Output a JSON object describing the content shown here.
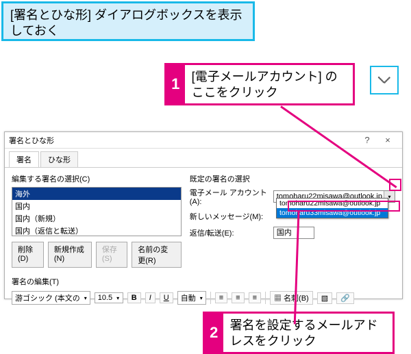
{
  "banner": "[署名とひな形] ダイアログボックスを表示しておく",
  "callout1": {
    "num": "1",
    "text": "[電子メールアカウント] のここをクリック"
  },
  "callout2": {
    "num": "2",
    "text": "署名を設定するメールアドレスをクリック"
  },
  "chevIcon": "chevron-down-icon",
  "dialog": {
    "title": "署名とひな形",
    "help": "?",
    "close": "×",
    "tabs": {
      "active": "署名",
      "inactive": "ひな形"
    },
    "left": {
      "label": "編集する署名の選択(C)",
      "items": [
        "海外",
        "国内",
        "国内（新規）",
        "国内（返信と転送）"
      ],
      "selectedIndex": 0,
      "buttons": {
        "delete": "削除(D)",
        "new": "新規作成(N)",
        "save": "保存(S)",
        "rename": "名前の変更(R)"
      }
    },
    "right": {
      "label": "既定の署名の選択",
      "rows": {
        "account": {
          "lbl": "電子メール アカウント(A):",
          "value": "tomoharu22misawa@outlook.jp"
        },
        "newmsg": {
          "lbl": "新しいメッセージ(M):"
        },
        "reply": {
          "lbl": "返信/転送(E):",
          "value": "国内"
        }
      },
      "dropdown": {
        "options": [
          "tomoharu22misawa@outlook.jp",
          "tomoharu33misawa@outlook.jp"
        ],
        "highlightIndex": 1
      }
    },
    "edit": {
      "label": "署名の編集(T)",
      "font": "游ゴシック (本文の",
      "size": "10.5",
      "autoLabel": "自動",
      "cardBtn": "名刺(B)"
    }
  }
}
